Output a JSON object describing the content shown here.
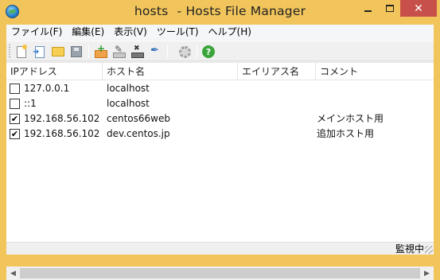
{
  "window": {
    "title_file": "hosts",
    "title_app": "- Hosts File Manager",
    "close_glyph": "✕"
  },
  "menu": [
    {
      "label": "ファイル(F)"
    },
    {
      "label": "編集(E)"
    },
    {
      "label": "表示(V)"
    },
    {
      "label": "ツール(T)"
    },
    {
      "label": "ヘルプ(H)"
    }
  ],
  "toolbar": {
    "icons": [
      "new-file-icon",
      "import-icon",
      "open-folder-icon",
      "save-icon",
      "add-entry-icon",
      "edit-entry-icon",
      "delete-entry-icon",
      "edit-pen-icon",
      "settings-gear-icon",
      "help-icon"
    ],
    "help_glyph": "?"
  },
  "table": {
    "columns": [
      "IPアドレス",
      "ホスト名",
      "エイリアス名",
      "コメント"
    ],
    "rows": [
      {
        "checked": false,
        "ip": "127.0.0.1",
        "host": "localhost",
        "alias": "",
        "comment": ""
      },
      {
        "checked": false,
        "ip": "::1",
        "host": "localhost",
        "alias": "",
        "comment": ""
      },
      {
        "checked": true,
        "ip": "192.168.56.102",
        "host": "centos66web",
        "alias": "",
        "comment": "メインホスト用"
      },
      {
        "checked": true,
        "ip": "192.168.56.102",
        "host": "dev.centos.jp",
        "alias": "",
        "comment": "追加ホスト用"
      }
    ]
  },
  "status": {
    "text": "監視中"
  },
  "colors": {
    "frame": "#f2c55c",
    "close_button": "#c7504a",
    "help_icon": "#3aa53a"
  }
}
